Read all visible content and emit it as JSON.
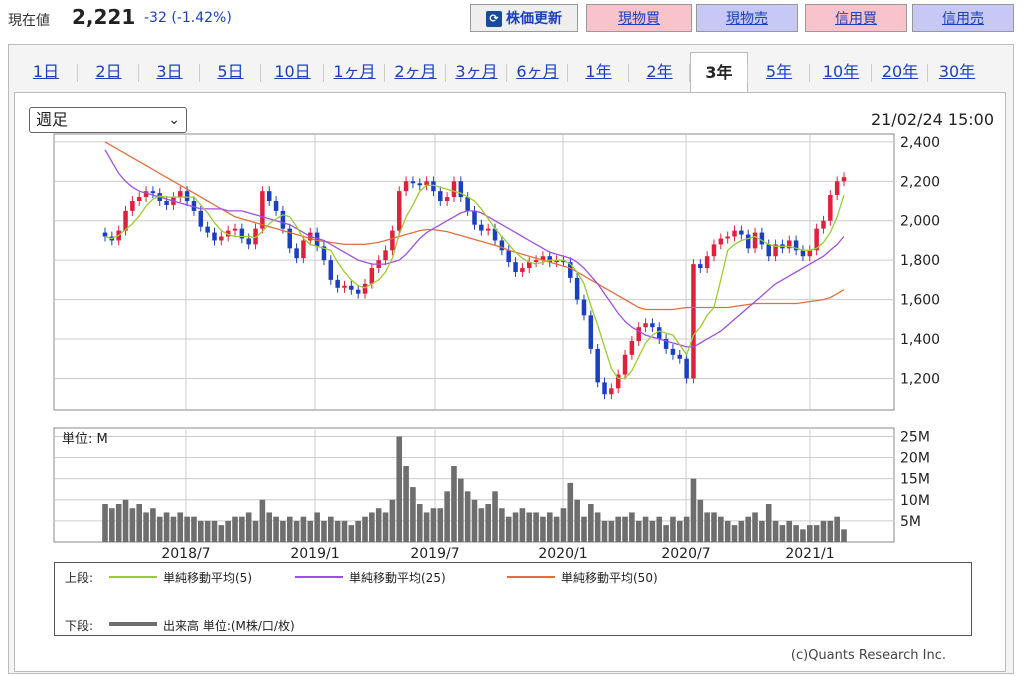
{
  "quote": {
    "label": "現在値",
    "price": "2,221",
    "change": "-32",
    "change_pct": "(-1.42%)"
  },
  "buttons": {
    "refresh": "株価更新",
    "spot_buy": "現物買",
    "spot_sell": "現物売",
    "margin_buy": "信用買",
    "margin_sell": "信用売"
  },
  "tabs": [
    "1日",
    "2日",
    "3日",
    "5日",
    "10日",
    "1ヶ月",
    "2ヶ月",
    "3ヶ月",
    "6ヶ月",
    "1年",
    "2年",
    "3年",
    "5年",
    "10年",
    "20年",
    "30年"
  ],
  "active_tab": "3年",
  "period_select": "週足",
  "timestamp": "21/02/24 15:00",
  "volume_unit_label": "単位: M",
  "legend": {
    "upper_label": "上段:",
    "lower_label": "下段:",
    "ma5": "単純移動平均(5)",
    "ma25": "単純移動平均(25)",
    "ma50": "単純移動平均(50)",
    "volume": "出来高 単位:(M株/口/枚)"
  },
  "copyright": "(c)Quants Research Inc.",
  "colors": {
    "ma5": "#9acd32",
    "ma25": "#a050e0",
    "ma50": "#e07040",
    "candle": "#1a3fbf",
    "candle_up": "#e0203c",
    "volume": "#6e6e6e"
  },
  "chart_data": {
    "type": "candlestick",
    "y_ticks": [
      1200,
      1400,
      1600,
      1800,
      2000,
      2200,
      2400
    ],
    "ylim": [
      1040,
      2440
    ],
    "volume_ticks": [
      "5M",
      "10M",
      "15M",
      "20M",
      "25M"
    ],
    "volume_ylim": [
      0,
      27
    ],
    "x_ticks": [
      "2018/7",
      "2019/1",
      "2019/7",
      "2020/1",
      "2020/7",
      "2021/1"
    ],
    "close": [
      1920,
      1900,
      1950,
      2050,
      2100,
      2120,
      2150,
      2140,
      2100,
      2080,
      2120,
      2150,
      2100,
      2050,
      1970,
      1940,
      1900,
      1920,
      1950,
      1960,
      1910,
      1880,
      1960,
      2150,
      2100,
      2050,
      1960,
      1860,
      1810,
      1900,
      1940,
      1870,
      1800,
      1700,
      1660,
      1670,
      1650,
      1630,
      1680,
      1760,
      1800,
      1850,
      1950,
      2150,
      2200,
      2190,
      2180,
      2200,
      2150,
      2100,
      2120,
      2200,
      2120,
      2050,
      1980,
      1950,
      1960,
      1900,
      1850,
      1790,
      1740,
      1760,
      1790,
      1800,
      1820,
      1790,
      1800,
      1790,
      1710,
      1600,
      1520,
      1350,
      1180,
      1120,
      1150,
      1220,
      1320,
      1390,
      1460,
      1480,
      1460,
      1400,
      1350,
      1320,
      1300,
      1200,
      1780,
      1760,
      1820,
      1880,
      1910,
      1920,
      1950,
      1930,
      1860,
      1940,
      1880,
      1820,
      1880,
      1860,
      1900,
      1850,
      1820,
      1850,
      1960,
      2000,
      2130,
      2200,
      2221
    ],
    "volume": [
      9,
      8,
      9,
      10,
      8,
      9,
      7,
      8,
      6,
      7,
      6,
      7,
      6,
      6,
      5,
      5,
      5,
      4,
      5,
      6,
      6,
      7,
      5,
      10,
      7,
      6,
      5,
      6,
      5,
      6,
      5,
      7,
      5,
      6,
      5,
      5,
      4,
      5,
      6,
      7,
      8,
      7,
      10,
      25,
      18,
      13,
      9,
      7,
      8,
      8,
      12,
      18,
      15,
      12,
      10,
      8,
      9,
      12,
      8,
      6,
      7,
      8,
      7,
      7,
      6,
      7,
      6,
      8,
      14,
      10,
      6,
      9,
      7,
      5,
      5,
      6,
      6,
      7,
      5,
      6,
      5,
      6,
      4,
      6,
      5,
      6,
      15,
      10,
      7,
      7,
      6,
      5,
      4,
      5,
      6,
      7,
      5,
      9,
      5,
      4,
      5,
      4,
      3,
      4,
      4,
      5,
      5,
      6,
      3
    ],
    "ma5": [
      1920,
      1910,
      1925,
      1955,
      1985,
      2025,
      2075,
      2110,
      2125,
      2120,
      2120,
      2120,
      2120,
      2120,
      2080,
      2040,
      1990,
      1950,
      1930,
      1920,
      1920,
      1920,
      1915,
      1945,
      1985,
      2010,
      2030,
      2020,
      1970,
      1910,
      1880,
      1870,
      1860,
      1850,
      1790,
      1740,
      1700,
      1670,
      1660,
      1680,
      1700,
      1740,
      1810,
      1930,
      2020,
      2080,
      2150,
      2180,
      2180,
      2170,
      2160,
      2150,
      2140,
      2120,
      2100,
      2060,
      2010,
      1960,
      1920,
      1880,
      1840,
      1810,
      1790,
      1780,
      1790,
      1800,
      1800,
      1800,
      1780,
      1740,
      1680,
      1570,
      1470,
      1360,
      1250,
      1200,
      1200,
      1240,
      1310,
      1380,
      1420,
      1440,
      1430,
      1420,
      1370,
      1320,
      1420,
      1460,
      1520,
      1560,
      1700,
      1850,
      1880,
      1900,
      1910,
      1920,
      1900,
      1880,
      1870,
      1870,
      1870,
      1860,
      1850,
      1850,
      1860,
      1890,
      1940,
      2020,
      2130
    ],
    "ma25": [
      2360,
      2300,
      2240,
      2200,
      2170,
      2150,
      2140,
      2130,
      2120,
      2110,
      2100,
      2090,
      2080,
      2070,
      2060,
      2060,
      2060,
      2060,
      2050,
      2050,
      2050,
      2040,
      2030,
      2020,
      2010,
      2000,
      1990,
      1980,
      1960,
      1940,
      1920,
      1910,
      1900,
      1880,
      1860,
      1840,
      1820,
      1800,
      1790,
      1780,
      1780,
      1780,
      1790,
      1800,
      1830,
      1870,
      1910,
      1940,
      1960,
      1980,
      2000,
      2020,
      2040,
      2050,
      2050,
      2040,
      2020,
      2000,
      1980,
      1960,
      1940,
      1920,
      1900,
      1880,
      1860,
      1840,
      1830,
      1820,
      1810,
      1790,
      1760,
      1720,
      1680,
      1630,
      1580,
      1530,
      1490,
      1460,
      1440,
      1420,
      1410,
      1400,
      1390,
      1380,
      1370,
      1360,
      1360,
      1380,
      1400,
      1420,
      1440,
      1470,
      1500,
      1530,
      1560,
      1590,
      1620,
      1650,
      1680,
      1700,
      1720,
      1740,
      1760,
      1780,
      1800,
      1820,
      1850,
      1880,
      1920
    ],
    "ma50": [
      2400,
      2380,
      2360,
      2340,
      2320,
      2300,
      2280,
      2260,
      2240,
      2220,
      2200,
      2180,
      2160,
      2140,
      2120,
      2100,
      2080,
      2060,
      2040,
      2020,
      2010,
      2000,
      1990,
      1980,
      1970,
      1960,
      1950,
      1940,
      1930,
      1920,
      1910,
      1900,
      1895,
      1890,
      1885,
      1880,
      1880,
      1880,
      1880,
      1885,
      1890,
      1900,
      1910,
      1920,
      1930,
      1940,
      1950,
      1955,
      1955,
      1950,
      1945,
      1935,
      1925,
      1915,
      1905,
      1895,
      1885,
      1875,
      1865,
      1850,
      1840,
      1830,
      1820,
      1810,
      1800,
      1790,
      1780,
      1770,
      1760,
      1740,
      1720,
      1700,
      1680,
      1660,
      1640,
      1620,
      1600,
      1580,
      1560,
      1550,
      1550,
      1550,
      1550,
      1550,
      1555,
      1560,
      1560,
      1560,
      1560,
      1560,
      1560,
      1560,
      1565,
      1570,
      1575,
      1580,
      1580,
      1580,
      1580,
      1580,
      1580,
      1580,
      1585,
      1590,
      1595,
      1600,
      1610,
      1630,
      1650
    ]
  }
}
